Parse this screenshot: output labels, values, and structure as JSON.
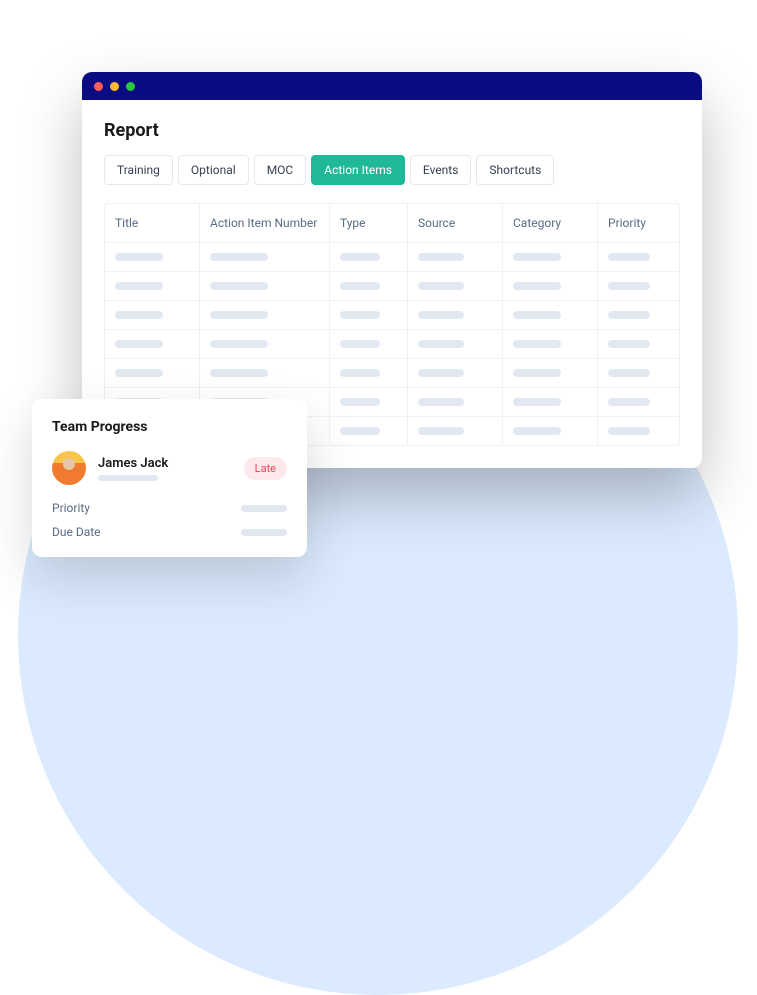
{
  "report": {
    "title": "Report",
    "tabs": [
      {
        "label": "Training",
        "active": false
      },
      {
        "label": "Optional",
        "active": false
      },
      {
        "label": "MOC",
        "active": false
      },
      {
        "label": "Action Items",
        "active": true
      },
      {
        "label": "Events",
        "active": false
      },
      {
        "label": "Shortcuts",
        "active": false
      }
    ],
    "columns": [
      "Title",
      "Action Item Number",
      "Type",
      "Source",
      "Category",
      "Priority"
    ],
    "row_count": 7
  },
  "team_card": {
    "title": "Team Progress",
    "member_name": "James Jack",
    "badge": "Late",
    "details": [
      "Priority",
      "Due Date"
    ]
  }
}
